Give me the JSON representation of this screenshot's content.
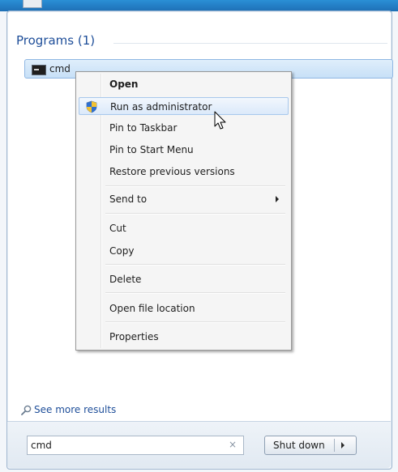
{
  "section": {
    "title": "Programs (1)"
  },
  "program": {
    "label": "cmd",
    "icon": "command-prompt-icon"
  },
  "context_menu": {
    "items": [
      {
        "label": "Open",
        "bold": true
      },
      {
        "label": "Run as administrator",
        "highlighted": true,
        "icon": "uac-shield-icon"
      },
      {
        "label": "Pin to Taskbar"
      },
      {
        "label": "Pin to Start Menu"
      },
      {
        "label": "Restore previous versions"
      },
      {
        "label": "Send to",
        "submenu": true
      },
      {
        "label": "Cut"
      },
      {
        "label": "Copy"
      },
      {
        "label": "Delete"
      },
      {
        "label": "Open file location"
      },
      {
        "label": "Properties"
      }
    ]
  },
  "see_more": {
    "label": "See more results",
    "icon": "search-icon"
  },
  "search": {
    "value": "cmd",
    "clear_glyph": "×"
  },
  "shutdown": {
    "label": "Shut down"
  },
  "colors": {
    "link": "#1e4e99",
    "highlight_border": "#a8c8ec",
    "frame_border": "#9fb6cf"
  }
}
